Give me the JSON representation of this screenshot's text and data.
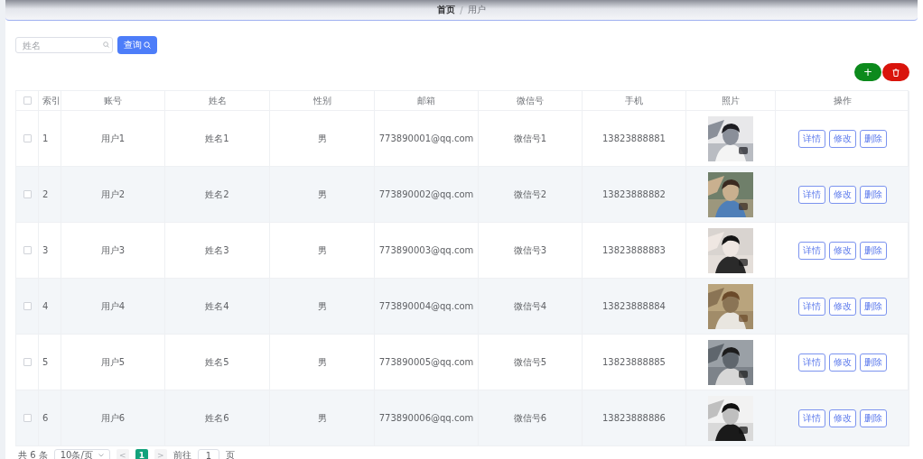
{
  "breadcrumb": {
    "items": [
      {
        "label": "首页",
        "current": false
      },
      {
        "label": "用户",
        "current": true
      }
    ],
    "separator": "/"
  },
  "search": {
    "placeholder": "姓名",
    "button": "查询"
  },
  "toolbar": {
    "add_button": "+"
  },
  "table": {
    "header_checked": false,
    "columns": [
      "索引",
      "账号",
      "姓名",
      "性别",
      "邮箱",
      "微信号",
      "手机",
      "照片",
      "操作"
    ],
    "rows": [
      {
        "checked": false,
        "index": "1",
        "account": "用户1",
        "name": "姓名1",
        "gender": "男",
        "email": "773890001@qq.com",
        "wechat": "微信号1",
        "phone": "13823888881",
        "actions": [
          "详情",
          "修改",
          "删除"
        ]
      },
      {
        "checked": false,
        "index": "2",
        "account": "用户2",
        "name": "姓名2",
        "gender": "男",
        "email": "773890002@qq.com",
        "wechat": "微信号2",
        "phone": "13823888882",
        "actions": [
          "详情",
          "修改",
          "删除"
        ]
      },
      {
        "checked": false,
        "index": "3",
        "account": "用户3",
        "name": "姓名3",
        "gender": "男",
        "email": "773890003@qq.com",
        "wechat": "微信号3",
        "phone": "13823888883",
        "actions": [
          "详情",
          "修改",
          "删除"
        ]
      },
      {
        "checked": false,
        "index": "4",
        "account": "用户4",
        "name": "姓名4",
        "gender": "男",
        "email": "773890004@qq.com",
        "wechat": "微信号4",
        "phone": "13823888884",
        "actions": [
          "详情",
          "修改",
          "删除"
        ]
      },
      {
        "checked": false,
        "index": "5",
        "account": "用户5",
        "name": "姓名5",
        "gender": "男",
        "email": "773890005@qq.com",
        "wechat": "微信号5",
        "phone": "13823888885",
        "actions": [
          "详情",
          "修改",
          "删除"
        ]
      },
      {
        "checked": false,
        "index": "6",
        "account": "用户6",
        "name": "姓名6",
        "gender": "男",
        "email": "773890006@qq.com",
        "wechat": "微信号6",
        "phone": "13823888886",
        "actions": [
          "详情",
          "修改",
          "删除"
        ]
      }
    ]
  },
  "pagination": {
    "total": "共 6 条",
    "page_size": "10条/页",
    "prev": "<",
    "pages": [
      {
        "label": "1",
        "selected": true
      }
    ],
    "next": ">",
    "goto_label": "前往",
    "goto_value": "1",
    "goto_suffix": "页"
  }
}
